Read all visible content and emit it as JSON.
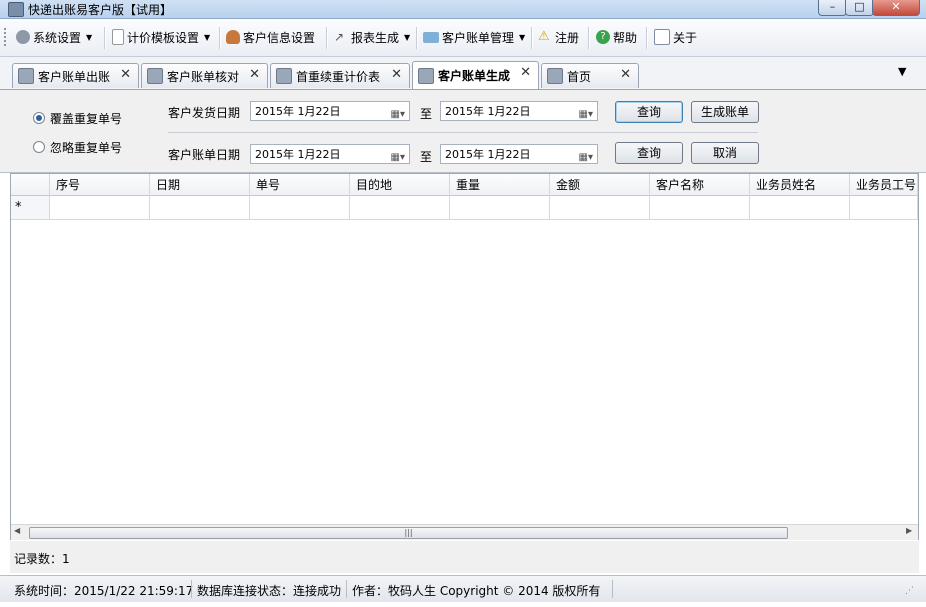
{
  "window": {
    "title": "快递出账易客户版【试用】",
    "controls": {
      "minimize": "–",
      "maximize": "□",
      "close": "✕"
    }
  },
  "toolbar": {
    "items": [
      {
        "label": "系统设置",
        "icon": "gear-icon",
        "dropdown": true
      },
      {
        "label": "计价模板设置",
        "icon": "document-icon",
        "dropdown": true
      },
      {
        "label": "客户信息设置",
        "icon": "user-icon",
        "dropdown": false
      },
      {
        "label": "报表生成",
        "icon": "wand-icon",
        "dropdown": true
      },
      {
        "label": "客户账单管理",
        "icon": "folder-icon",
        "dropdown": true
      },
      {
        "label": "注册",
        "icon": "warning-icon",
        "dropdown": false
      },
      {
        "label": "帮助",
        "icon": "help-icon",
        "dropdown": false
      },
      {
        "label": "关于",
        "icon": "info-icon",
        "dropdown": false
      }
    ]
  },
  "tabs": [
    {
      "label": "客户账单出账",
      "active": false
    },
    {
      "label": "客户账单核对",
      "active": false
    },
    {
      "label": "首重续重计价表",
      "active": false
    },
    {
      "label": "客户账单生成",
      "active": true
    },
    {
      "label": "首页",
      "active": false
    }
  ],
  "filters": {
    "radio_overwrite": "覆盖重复单号",
    "radio_ignore": "忽略重复单号",
    "ship_date_label": "客户发货日期",
    "bill_date_label": "客户账单日期",
    "to_label": "至",
    "ship_date_from": "2015年  1月22日",
    "ship_date_to": "2015年  1月22日",
    "bill_date_from": "2015年  1月22日",
    "bill_date_to": "2015年  1月22日",
    "query_button": "查询",
    "generate_button": "生成账单",
    "query_button_2": "查询",
    "cancel_button": "取消"
  },
  "grid": {
    "columns": [
      "序号",
      "日期",
      "单号",
      "目的地",
      "重量",
      "金额",
      "客户名称",
      "业务员姓名",
      "业务员工号"
    ],
    "new_row_marker": "*"
  },
  "record_count": "记录数：1",
  "status": {
    "time": "系统时间：2015/1/22 21:59:17",
    "db": "数据库连接状态：连接成功",
    "author": "作者：牧码人生 Copyright ©  2014 版权所有"
  },
  "colors": {
    "accent": "#2b5fa8",
    "tab_border": "#9aa6b8",
    "panel_bg": "#f0f0f0"
  }
}
